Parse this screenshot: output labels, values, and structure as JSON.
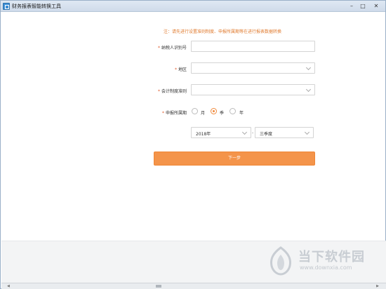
{
  "window": {
    "title": "财务报表智能转换工具",
    "minimize_glyph": "–",
    "maximize_glyph": "□",
    "close_glyph": "✕"
  },
  "notice": "注：请先进行设置准则制度、申报所属期等在进行报表数据转换",
  "form": {
    "required_mark": "*",
    "taxpayer_id": {
      "label": "纳税人识别号",
      "value": ""
    },
    "region": {
      "label": "地区",
      "value": ""
    },
    "accounting_standard": {
      "label": "会计制度准则",
      "value": ""
    },
    "filing_period": {
      "label": "申报所属期",
      "options": [
        "月",
        "季",
        "年"
      ],
      "selected": "季"
    },
    "year_select": {
      "value": "2018年"
    },
    "separator": "-",
    "quarter_select": {
      "value": "三季度"
    },
    "next_button": "下一步"
  },
  "watermark": {
    "name": "当下软件园",
    "url": "www.downxia.com"
  },
  "colors": {
    "accent": "#f4944a",
    "notice": "#e07a2e",
    "required": "#e05a2a"
  }
}
